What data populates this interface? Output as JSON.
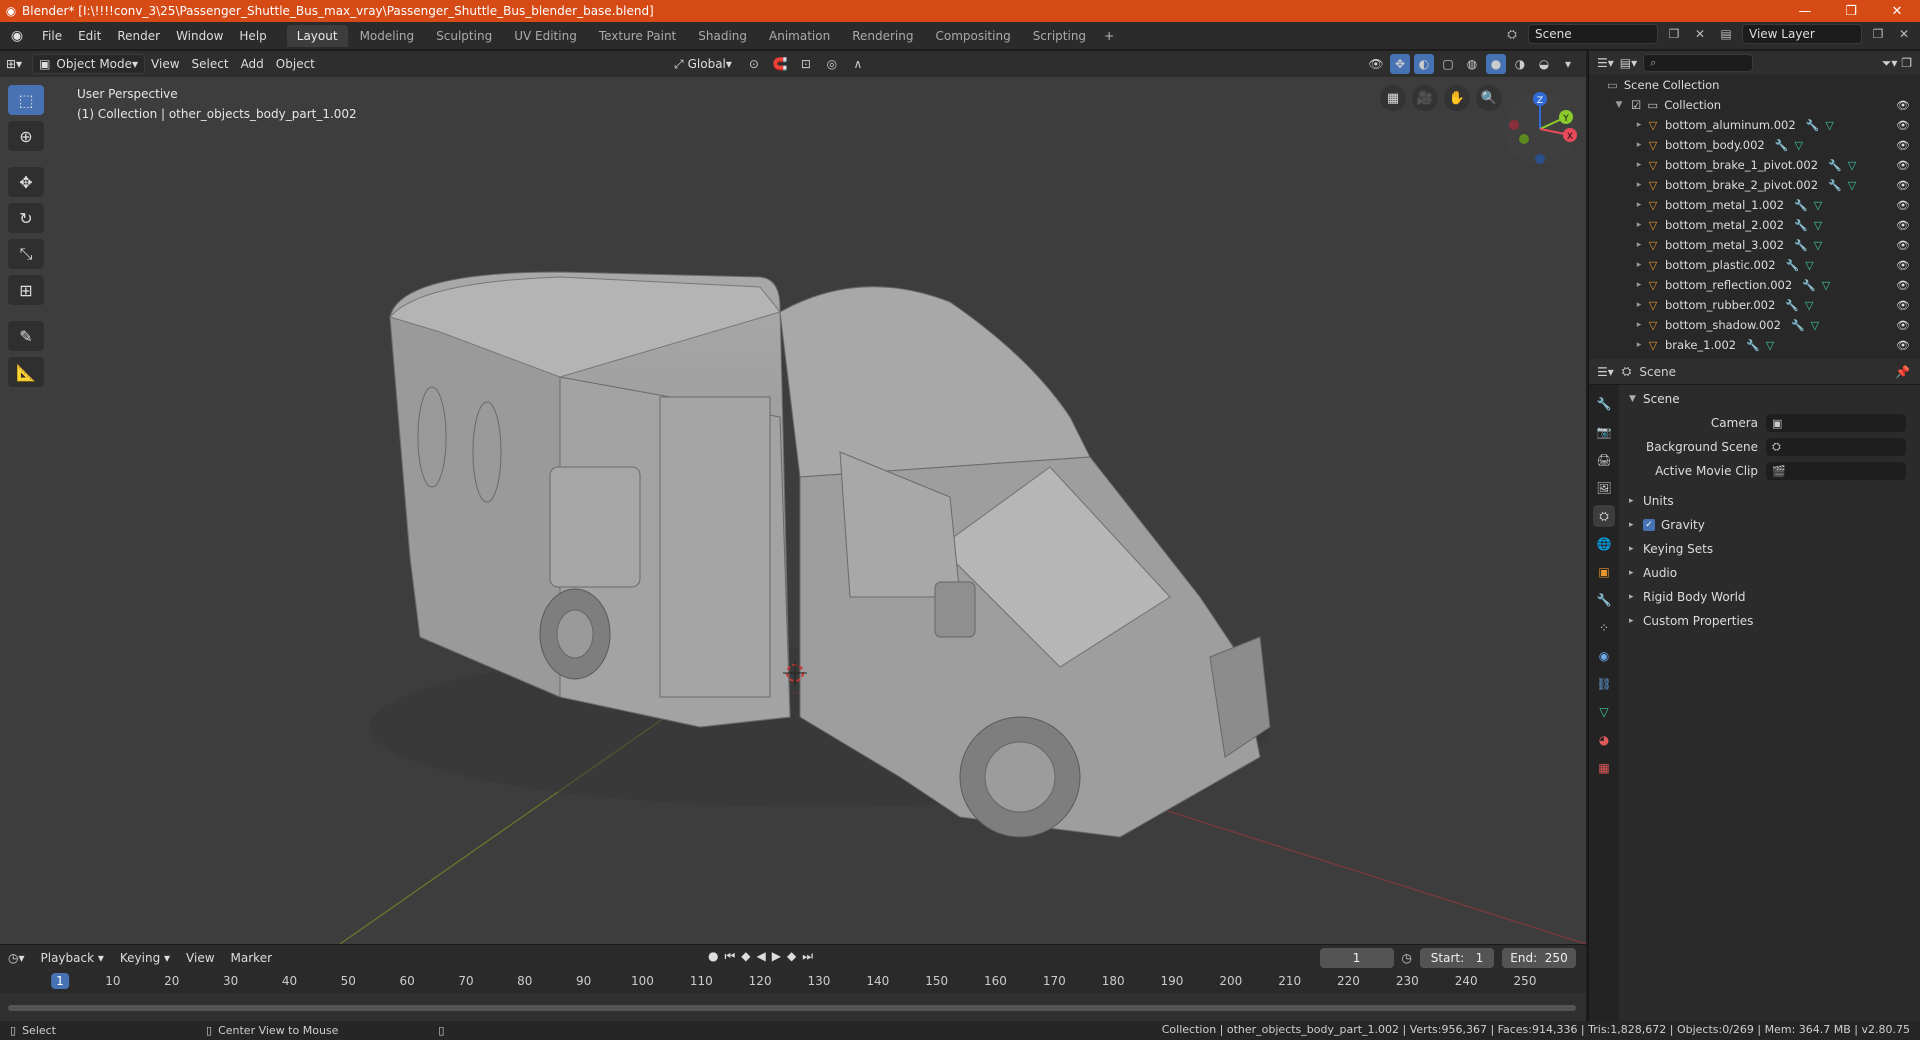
{
  "window": {
    "title": "Blender* [I:\\!!!!conv_3\\25\\Passenger_Shuttle_Bus_max_vray\\Passenger_Shuttle_Bus_blender_base.blend]",
    "min": "—",
    "max": "❐",
    "close": "✕"
  },
  "menu": {
    "file": "File",
    "edit": "Edit",
    "render": "Render",
    "window": "Window",
    "help": "Help"
  },
  "workspaces": [
    "Layout",
    "Modeling",
    "Sculpting",
    "UV Editing",
    "Texture Paint",
    "Shading",
    "Animation",
    "Rendering",
    "Compositing",
    "Scripting"
  ],
  "active_workspace": "Layout",
  "scene_field": "Scene",
  "view_layer_field": "View Layer",
  "viewport_header": {
    "mode": "Object Mode",
    "view": "View",
    "select": "Select",
    "add": "Add",
    "object": "Object",
    "transform_orientation": "Global"
  },
  "viewport": {
    "perspective": "User Perspective",
    "collection_info": "(1) Collection | other_objects_body_part_1.002",
    "gizmo": {
      "x": "X",
      "y": "Y",
      "z": "Z"
    }
  },
  "outliner": {
    "root": "Scene Collection",
    "collection": "Collection",
    "items": [
      "bottom_aluminum.002",
      "bottom_body.002",
      "bottom_brake_1_pivot.002",
      "bottom_brake_2_pivot.002",
      "bottom_metal_1.002",
      "bottom_metal_2.002",
      "bottom_metal_3.002",
      "bottom_plastic.002",
      "bottom_reflection.002",
      "bottom_rubber.002",
      "bottom_shadow.002",
      "brake_1.002"
    ]
  },
  "properties": {
    "header": "Scene",
    "section": "Scene",
    "camera_label": "Camera",
    "background_scene_label": "Background Scene",
    "active_movie_clip_label": "Active Movie Clip",
    "panels": [
      "Units",
      "Gravity",
      "Keying Sets",
      "Audio",
      "Rigid Body World",
      "Custom Properties"
    ],
    "gravity_checked": true
  },
  "timeline": {
    "playback": "Playback",
    "keying": "Keying",
    "view": "View",
    "marker": "Marker",
    "current_frame": "1",
    "start_label": "Start:",
    "start": "1",
    "end_label": "End:",
    "end": "250",
    "ticks": [
      "1",
      "10",
      "20",
      "30",
      "40",
      "50",
      "60",
      "70",
      "80",
      "90",
      "100",
      "110",
      "120",
      "130",
      "140",
      "150",
      "160",
      "170",
      "180",
      "190",
      "200",
      "210",
      "220",
      "230",
      "240",
      "250"
    ]
  },
  "statusbar": {
    "select": "Select",
    "center_view": "Center View to Mouse",
    "stats": "Collection | other_objects_body_part_1.002 | Verts:956,367 | Faces:914,336 | Tris:1,828,672 | Objects:0/269 | Mem: 364.7 MB | v2.80.75"
  },
  "colors": {
    "accent": "#4772b3",
    "titlebar": "#d64a16",
    "object": "#e8962e",
    "modifier": "#6aa8e8",
    "mesh": "#3fc7a5"
  }
}
